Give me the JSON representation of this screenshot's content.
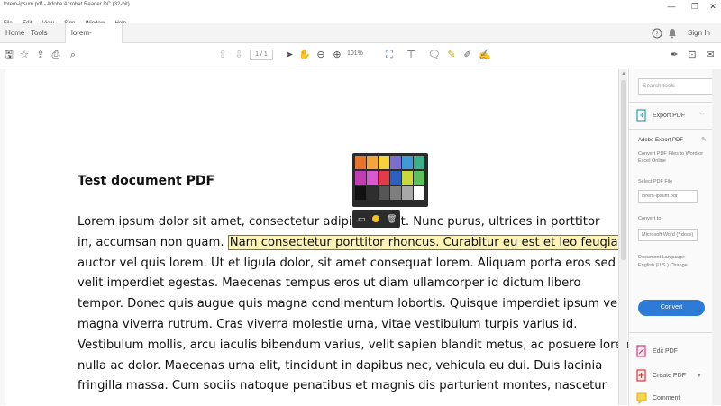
{
  "window": {
    "title": "lorem-ipsum.pdf - Adobe Acrobat Reader DC (32-bit)",
    "minimize": "—",
    "maximize": "❐",
    "close": "✕"
  },
  "menu": [
    "File",
    "Edit",
    "View",
    "Sign",
    "Window",
    "Help"
  ],
  "tabs": {
    "home": "Home",
    "tools": "Tools",
    "doc": "lorem-ipsum.pdf",
    "doc_close": "×"
  },
  "header_right": {
    "help": "?",
    "bell": "🔔",
    "sign_in": "Sign In"
  },
  "toolbar": {
    "page_current": "1",
    "page_total": "/ 1",
    "zoom": "101%"
  },
  "document": {
    "heading": "Test document PDF",
    "lines": [
      "Lorem ipsum dolor sit amet, consectetur adipiscing elit. Nunc purus, ultrices in porttitor",
      "auctor vel quis lorem. Ut et ligula dolor, sit amet consequat lorem. Aliquam porta eros sed",
      "velit imperdiet egestas. Maecenas tempus eros ut diam ullamcorper id dictum libero",
      "tempor. Donec quis augue quis magna condimentum lobortis. Quisque imperdiet ipsum vel",
      "magna viverra rutrum. Cras viverra molestie urna, vitae vestibulum turpis varius id.",
      "Vestibulum mollis, arcu iaculis bibendum varius, velit sapien blandit metus, ac posuere lorem",
      "nulla ac dolor. Maecenas urna elit, tincidunt in dapibus nec, vehicula eu dui. Duis lacinia",
      "fringilla massa. Cum sociis natoque penatibus et magnis dis parturient montes, nascetur"
    ],
    "line2_prefix": "in, accumsan non quam. ",
    "line2_highlight": "Nam consectetur porttitor rhoncus. Curabitur eu est et leo feugiat"
  },
  "palette_colors": [
    "#e8742a",
    "#f2a53a",
    "#f5d33a",
    "#7a6fd1",
    "#3f9ad6",
    "#3cb08a",
    "#c23bb4",
    "#d85ad0",
    "#e23b4a",
    "#2d5fbf",
    "#c9d93c",
    "#5ec05a",
    "#111111",
    "#2e2e2e",
    "#565656",
    "#7e7e7e",
    "#a8a8a8",
    "#ffffff"
  ],
  "right_panel": {
    "search_placeholder": "Search tools",
    "export_title": "Export PDF",
    "adobe_export_title": "Adobe Export PDF",
    "adobe_export_desc": "Convert PDF Files to Word or Excel Online",
    "select_label": "Select PDF File",
    "select_value": "lorem-ipsum.pdf",
    "convert_to_label": "Convert to",
    "convert_to_value": "Microsoft Word (*.docx)",
    "doc_lang_label": "Document Language:",
    "doc_lang_value": "English (U.S.) Change",
    "convert_button": "Convert",
    "edit_pdf": "Edit PDF",
    "create_pdf": "Create PDF",
    "comment": "Comment"
  }
}
